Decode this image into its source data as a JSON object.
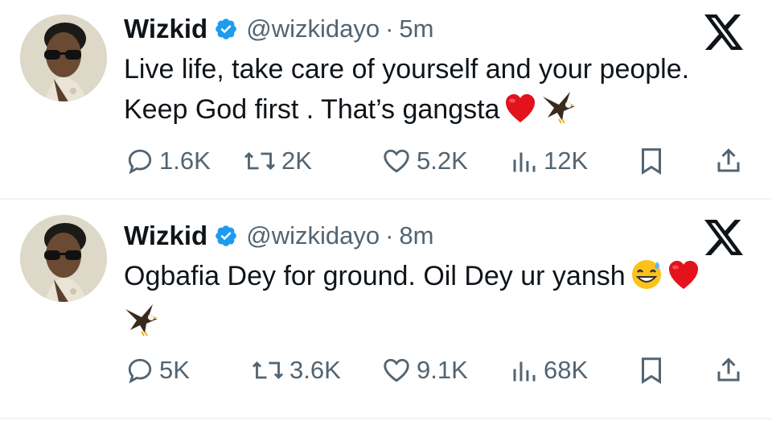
{
  "tweets": [
    {
      "name": "Wizkid",
      "handle": "@wizkidayo",
      "separator": "·",
      "time": "5m",
      "text_lines": [
        "Live life, take care of yourself and your people.",
        "Keep God first . That’s gangsta"
      ],
      "emojis": [
        "red-heart",
        "eagle"
      ],
      "replies": "1.6K",
      "reposts": "2K",
      "likes": "5.2K",
      "views": "12K"
    },
    {
      "name": "Wizkid",
      "handle": "@wizkidayo",
      "separator": "·",
      "time": "8m",
      "text_lines": [
        "Ogbafia Dey for ground. Oil Dey ur yansh"
      ],
      "emojis": [
        "grinning-sweat",
        "red-heart",
        "eagle"
      ],
      "replies": "5K",
      "reposts": "3.6K",
      "likes": "9.1K",
      "views": "68K"
    }
  ],
  "colors": {
    "text": "#0f1419",
    "secondary": "#536471",
    "verified": "#1d9bf0",
    "divider": "#eff3f4"
  }
}
